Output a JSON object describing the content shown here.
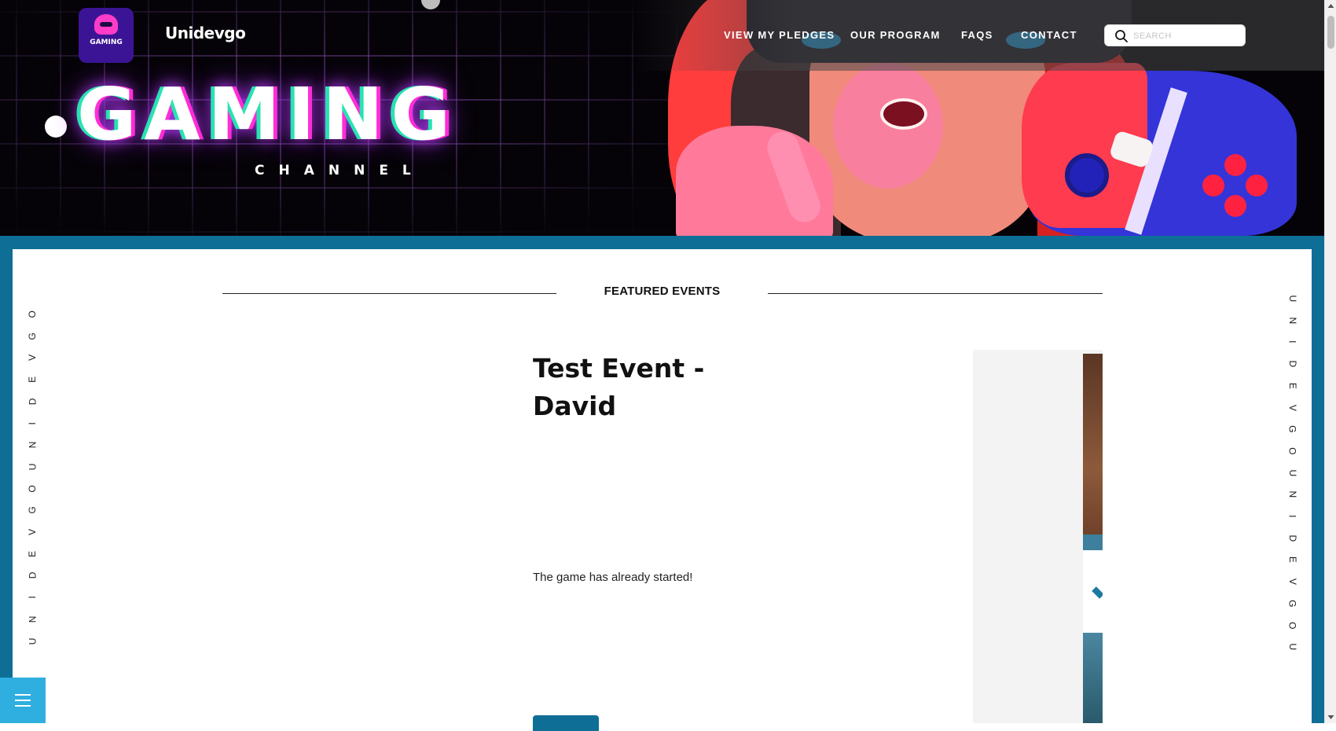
{
  "brand": {
    "name": "Unidevgo",
    "logo_text": "GAMING"
  },
  "nav": {
    "items": [
      {
        "label": "VIEW MY PLEDGES"
      },
      {
        "label": "OUR PROGRAM"
      },
      {
        "label": "FAQS"
      },
      {
        "label": "CONTACT"
      }
    ],
    "search": {
      "placeholder": "SEARCH",
      "value": ""
    }
  },
  "hero": {
    "title": "GAMING",
    "subtitle": "CHANNEL"
  },
  "side_text": {
    "left": [
      "O",
      "G",
      "V",
      "E",
      "D",
      "I",
      "N",
      "U",
      "O",
      "G",
      "V",
      "E",
      "D",
      "I",
      "N",
      "U"
    ],
    "right": [
      "U",
      "N",
      "I",
      "D",
      "E",
      "V",
      "G",
      "O",
      "U",
      "N",
      "I",
      "D",
      "E",
      "V",
      "G",
      "O",
      "U"
    ]
  },
  "section": {
    "heading": "FEATURED EVENTS"
  },
  "event": {
    "title": "Test Event - David",
    "description": "The game has already started!",
    "button_label": ""
  },
  "colors": {
    "frame": "#0f6e95",
    "fab": "#2faee0",
    "hero_bg": "#050307"
  },
  "icons": {
    "search": "search-icon",
    "menu": "hamburger-menu-icon"
  }
}
